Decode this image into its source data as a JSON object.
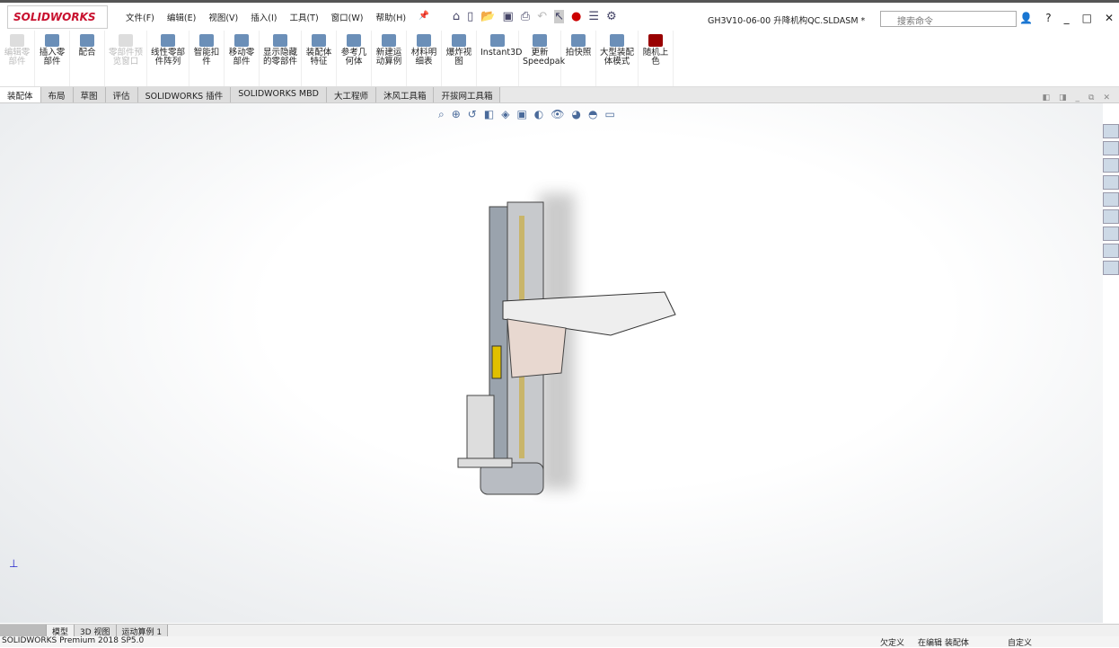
{
  "app": {
    "logo": "SOLIDWORKS",
    "document_title": "GH3V10-06-00 升降机构QC.SLDASM *"
  },
  "menu": [
    "文件(F)",
    "编辑(E)",
    "视图(V)",
    "插入(I)",
    "工具(T)",
    "窗口(W)",
    "帮助(H)"
  ],
  "search": {
    "placeholder": "搜索命令"
  },
  "ribbon": [
    {
      "label": "编辑零部件",
      "disabled": true
    },
    {
      "label": "插入零部件",
      "disabled": false
    },
    {
      "label": "配合",
      "disabled": false
    },
    {
      "label": "零部件预览窗口",
      "disabled": true
    },
    {
      "label": "线性零部件阵列",
      "disabled": false
    },
    {
      "label": "智能扣件",
      "disabled": false
    },
    {
      "label": "移动零部件",
      "disabled": false
    },
    {
      "label": "显示隐藏的零部件",
      "disabled": false
    },
    {
      "label": "装配体特征",
      "disabled": false
    },
    {
      "label": "参考几何体",
      "disabled": false
    },
    {
      "label": "新建运动算例",
      "disabled": false
    },
    {
      "label": "材料明细表",
      "disabled": false
    },
    {
      "label": "爆炸视图",
      "disabled": false
    },
    {
      "label": "Instant3D",
      "disabled": false
    },
    {
      "label": "更新Speedpak",
      "disabled": false
    },
    {
      "label": "拍快照",
      "disabled": false
    },
    {
      "label": "大型装配体模式",
      "disabled": false
    },
    {
      "label": "随机上色",
      "disabled": false
    }
  ],
  "tabs": [
    "装配体",
    "布局",
    "草图",
    "评估",
    "SOLIDWORKS 插件",
    "SOLIDWORKS MBD",
    "大工程师",
    "沐风工具箱",
    "开拔网工具箱"
  ],
  "bottom_tabs": [
    "模型",
    "3D 视图",
    "运动算例 1"
  ],
  "status": {
    "product": "SOLIDWORKS Premium 2018 SP5.0",
    "state": "欠定义",
    "mode": "在编辑 装配体",
    "units": "自定义"
  }
}
